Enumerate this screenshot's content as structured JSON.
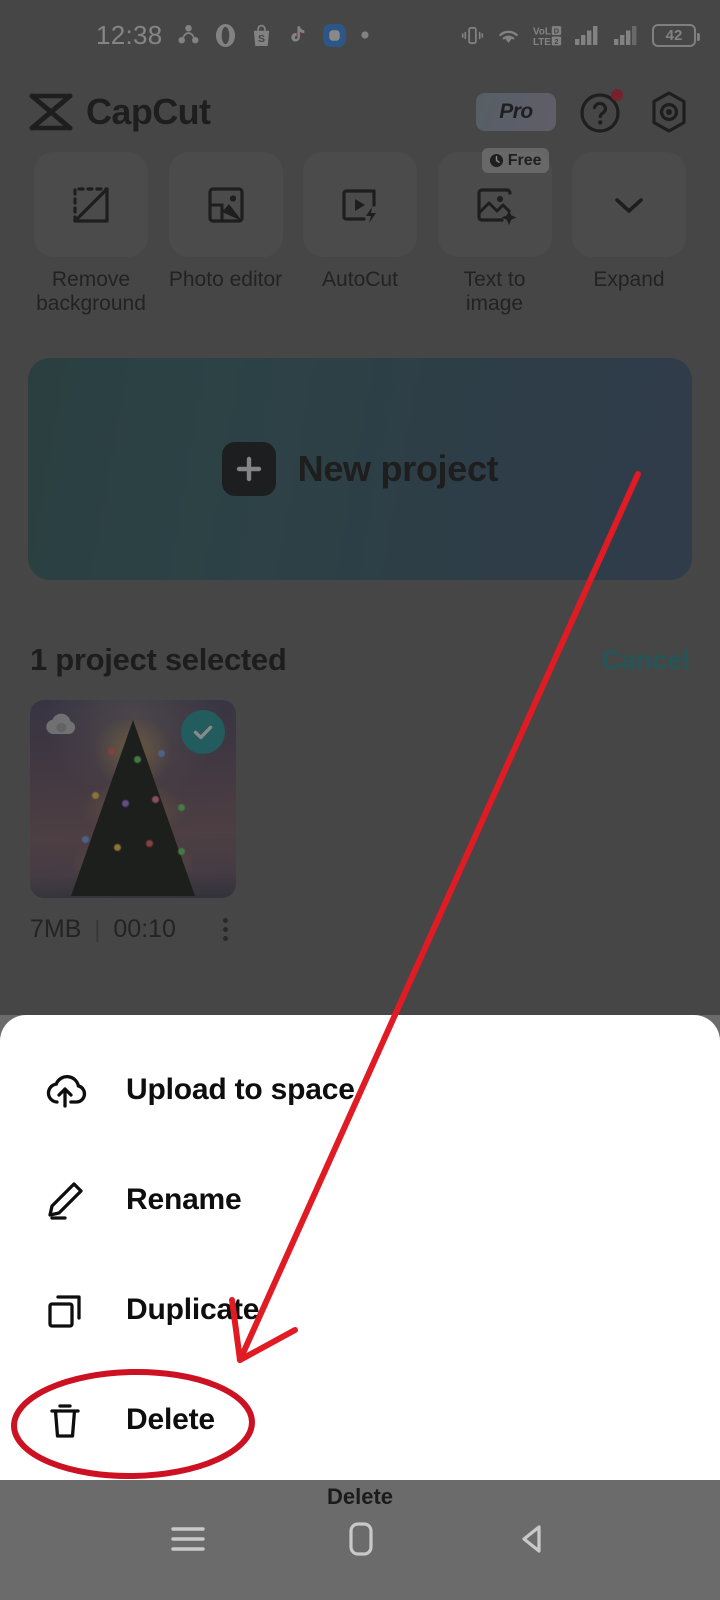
{
  "status_bar": {
    "time": "12:38",
    "battery_level": "42",
    "left_icons": [
      "share-icon",
      "opera-icon",
      "shopee-icon",
      "tiktok-icon",
      "messages-icon",
      "dot-icon"
    ],
    "right_icons": [
      "vibrate-icon",
      "wifi-icon",
      "volte-icon",
      "signal-sim1-icon",
      "signal-sim2-icon",
      "battery-icon"
    ]
  },
  "header": {
    "brand": "CapCut",
    "pro_label": "Pro",
    "help_icon": "question-circle-icon",
    "settings_icon": "gear-icon",
    "has_help_badge": true
  },
  "tools": [
    {
      "label": "Remove\nbackground",
      "icon": "remove-background-icon",
      "badge": null
    },
    {
      "label": "Photo editor",
      "icon": "photo-editor-icon",
      "badge": null
    },
    {
      "label": "AutoCut",
      "icon": "autocut-icon",
      "badge": null
    },
    {
      "label": "Text to image",
      "icon": "text-to-image-icon",
      "badge": "Free"
    },
    {
      "label": "Expand",
      "icon": "chevron-down-icon",
      "badge": null
    }
  ],
  "banner": {
    "label": "New project",
    "icon": "plus-icon",
    "gradient_start": "#2f5b5f",
    "gradient_end": "#3b5573"
  },
  "selection": {
    "count_label": "1 project selected",
    "cancel_label": "Cancel",
    "cancel_color": "#1f8f92"
  },
  "project": {
    "size": "7MB",
    "separator": "|",
    "duration": "00:10",
    "selected": true,
    "cloud_icon": "cloud-icon",
    "check_icon": "check-icon",
    "more_icon": "more-vertical-icon",
    "check_color": "#1b9ba1"
  },
  "sheet": {
    "items": [
      {
        "label": "Upload to space",
        "icon": "cloud-upload-icon"
      },
      {
        "label": "Rename",
        "icon": "pencil-icon"
      },
      {
        "label": "Duplicate",
        "icon": "copy-icon"
      },
      {
        "label": "Delete",
        "icon": "trash-icon"
      }
    ]
  },
  "annotation": {
    "color": "#e01b24",
    "highlighted_item": "Delete",
    "shapes": [
      "arrow",
      "ellipse"
    ]
  },
  "nav_bar": {
    "caption": "Delete",
    "buttons": [
      "menu-icon",
      "home-icon",
      "back-icon"
    ]
  }
}
